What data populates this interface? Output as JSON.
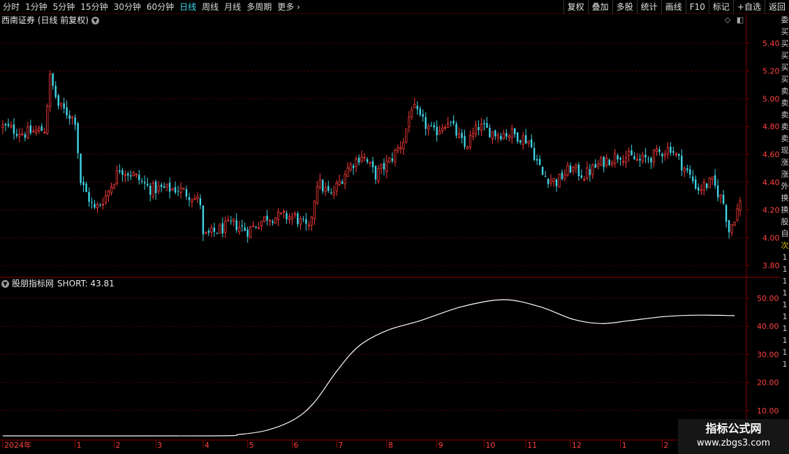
{
  "toolbar": {
    "periods": [
      "分时",
      "1分钟",
      "5分钟",
      "15分钟",
      "30分钟",
      "60分钟",
      "日线",
      "周线",
      "月线",
      "多周期",
      "更多"
    ],
    "active_period": "日线",
    "more_arrow": "›",
    "buttons": [
      "复权",
      "叠加",
      "多股",
      "统计",
      "画线",
      "F10",
      "标记",
      "+自选",
      "返回"
    ]
  },
  "chart_title": "西南证券 (日线 前复权)",
  "indicator": {
    "title": "股朋指标网",
    "label": "SHORT: 43.81",
    "value": 43.81
  },
  "icons": [
    "diamond-icon",
    "panel-toggle-icon"
  ],
  "sidebar_chars": [
    "委",
    "买",
    "买",
    "买",
    "买",
    "买",
    "卖",
    "卖",
    "卖",
    "卖",
    "卖",
    "现",
    "涨",
    "涨",
    "外",
    "换",
    "换",
    "股",
    "自",
    "次",
    "1",
    "1",
    "1",
    "1",
    "1",
    "1",
    "1",
    "1",
    "1",
    "1"
  ],
  "colors": {
    "up": "#ff3b3b",
    "down": "#3fd6e6",
    "grid": "#5a0000",
    "axis": "#8a0000",
    "axis_text": "#ff4040",
    "line": "#ffffff",
    "active": "#3fd6e6"
  },
  "watermark": {
    "line1": "指标公式网",
    "line2": "www.zbgs3.com"
  },
  "chart_data": [
    {
      "type": "candlestick",
      "title": "西南证券 (日线 前复权)",
      "ylim": [
        3.72,
        5.52
      ],
      "yticks": [
        3.8,
        4.0,
        4.2,
        4.4,
        4.6,
        4.8,
        5.0,
        5.2,
        5.4
      ],
      "ytick_labels": [
        "3.80",
        "4.00",
        "4.20",
        "4.40",
        "4.60",
        "4.80",
        "5.00",
        "5.20",
        "5.40"
      ],
      "key_closes": [
        [
          0,
          4.8
        ],
        [
          8,
          4.75
        ],
        [
          15,
          4.78
        ],
        [
          17,
          5.15
        ],
        [
          20,
          4.95
        ],
        [
          26,
          4.85
        ],
        [
          28,
          4.4
        ],
        [
          33,
          4.2
        ],
        [
          37,
          4.3
        ],
        [
          42,
          4.5
        ],
        [
          47,
          4.45
        ],
        [
          53,
          4.35
        ],
        [
          58,
          4.35
        ],
        [
          63,
          4.35
        ],
        [
          68,
          4.3
        ],
        [
          71,
          4.25
        ],
        [
          72,
          4.0
        ],
        [
          77,
          4.05
        ],
        [
          83,
          4.1
        ],
        [
          88,
          4.05
        ],
        [
          95,
          4.15
        ],
        [
          105,
          4.15
        ],
        [
          110,
          4.05
        ],
        [
          113,
          4.4
        ],
        [
          118,
          4.3
        ],
        [
          124,
          4.5
        ],
        [
          129,
          4.6
        ],
        [
          134,
          4.45
        ],
        [
          139,
          4.55
        ],
        [
          144,
          4.7
        ],
        [
          147,
          4.95
        ],
        [
          150,
          4.85
        ],
        [
          155,
          4.75
        ],
        [
          160,
          4.85
        ],
        [
          166,
          4.65
        ],
        [
          171,
          4.8
        ],
        [
          177,
          4.75
        ],
        [
          183,
          4.75
        ],
        [
          189,
          4.7
        ],
        [
          194,
          4.45
        ],
        [
          199,
          4.4
        ],
        [
          204,
          4.5
        ],
        [
          209,
          4.45
        ],
        [
          216,
          4.55
        ],
        [
          222,
          4.6
        ],
        [
          229,
          4.55
        ],
        [
          235,
          4.6
        ],
        [
          240,
          4.65
        ],
        [
          245,
          4.5
        ],
        [
          250,
          4.35
        ],
        [
          255,
          4.4
        ],
        [
          259,
          4.25
        ],
        [
          261,
          4.05
        ],
        [
          265,
          4.25
        ]
      ]
    },
    {
      "type": "line",
      "series": [
        {
          "name": "SHORT",
          "values": [
            [
              0,
              1.0
            ],
            [
              75,
              1.0
            ],
            [
              85,
              1.5
            ],
            [
              95,
              3.0
            ],
            [
              105,
              7.0
            ],
            [
              112,
              13.0
            ],
            [
              120,
              24.0
            ],
            [
              128,
              33.0
            ],
            [
              138,
              38.5
            ],
            [
              150,
              42.0
            ],
            [
              165,
              47.0
            ],
            [
              180,
              49.5
            ],
            [
              193,
              47.0
            ],
            [
              205,
              42.5
            ],
            [
              215,
              41.0
            ],
            [
              225,
              42.0
            ],
            [
              238,
              43.5
            ],
            [
              250,
              44.0
            ],
            [
              263,
              43.81
            ]
          ]
        }
      ],
      "ylim": [
        0,
        53
      ],
      "yticks": [
        10,
        20,
        30,
        40,
        50
      ],
      "ytick_labels": [
        "10.00",
        "20.00",
        "30.00",
        "40.00",
        "50.00"
      ]
    }
  ],
  "xaxis": {
    "labels": [
      "2024年",
      "1",
      "2",
      "3",
      "4",
      "5",
      "6",
      "7",
      "8",
      "9",
      "10",
      "11",
      "12",
      "1",
      "2"
    ],
    "label_days": [
      0,
      26,
      40,
      55,
      72,
      88,
      104,
      120,
      138,
      156,
      173,
      188,
      204,
      222,
      237
    ]
  }
}
